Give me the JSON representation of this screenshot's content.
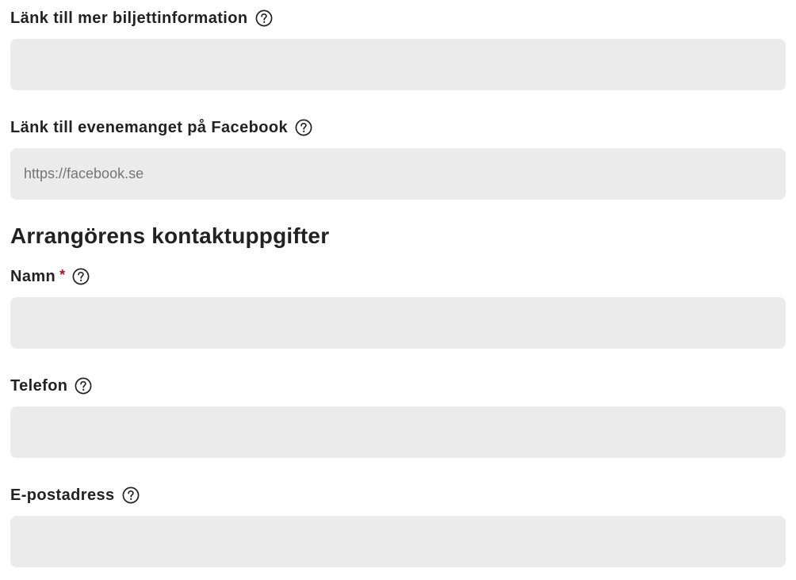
{
  "ticket_link": {
    "label": "Länk till mer biljettinformation",
    "value": "",
    "placeholder": ""
  },
  "facebook_link": {
    "label": "Länk till evenemanget på Facebook",
    "value": "",
    "placeholder": "https://facebook.se"
  },
  "organizer_section": {
    "heading": "Arrangörens kontaktuppgifter"
  },
  "name_field": {
    "label": "Namn",
    "required_marker": "*",
    "value": "",
    "placeholder": ""
  },
  "phone_field": {
    "label": "Telefon",
    "value": "",
    "placeholder": ""
  },
  "email_field": {
    "label": "E-postadress",
    "value": "",
    "placeholder": ""
  },
  "icons": {
    "help": "question-circle-icon"
  },
  "colors": {
    "field_background": "#ebebeb",
    "text": "#222222",
    "required": "#a3191f",
    "placeholder": "#757575"
  }
}
